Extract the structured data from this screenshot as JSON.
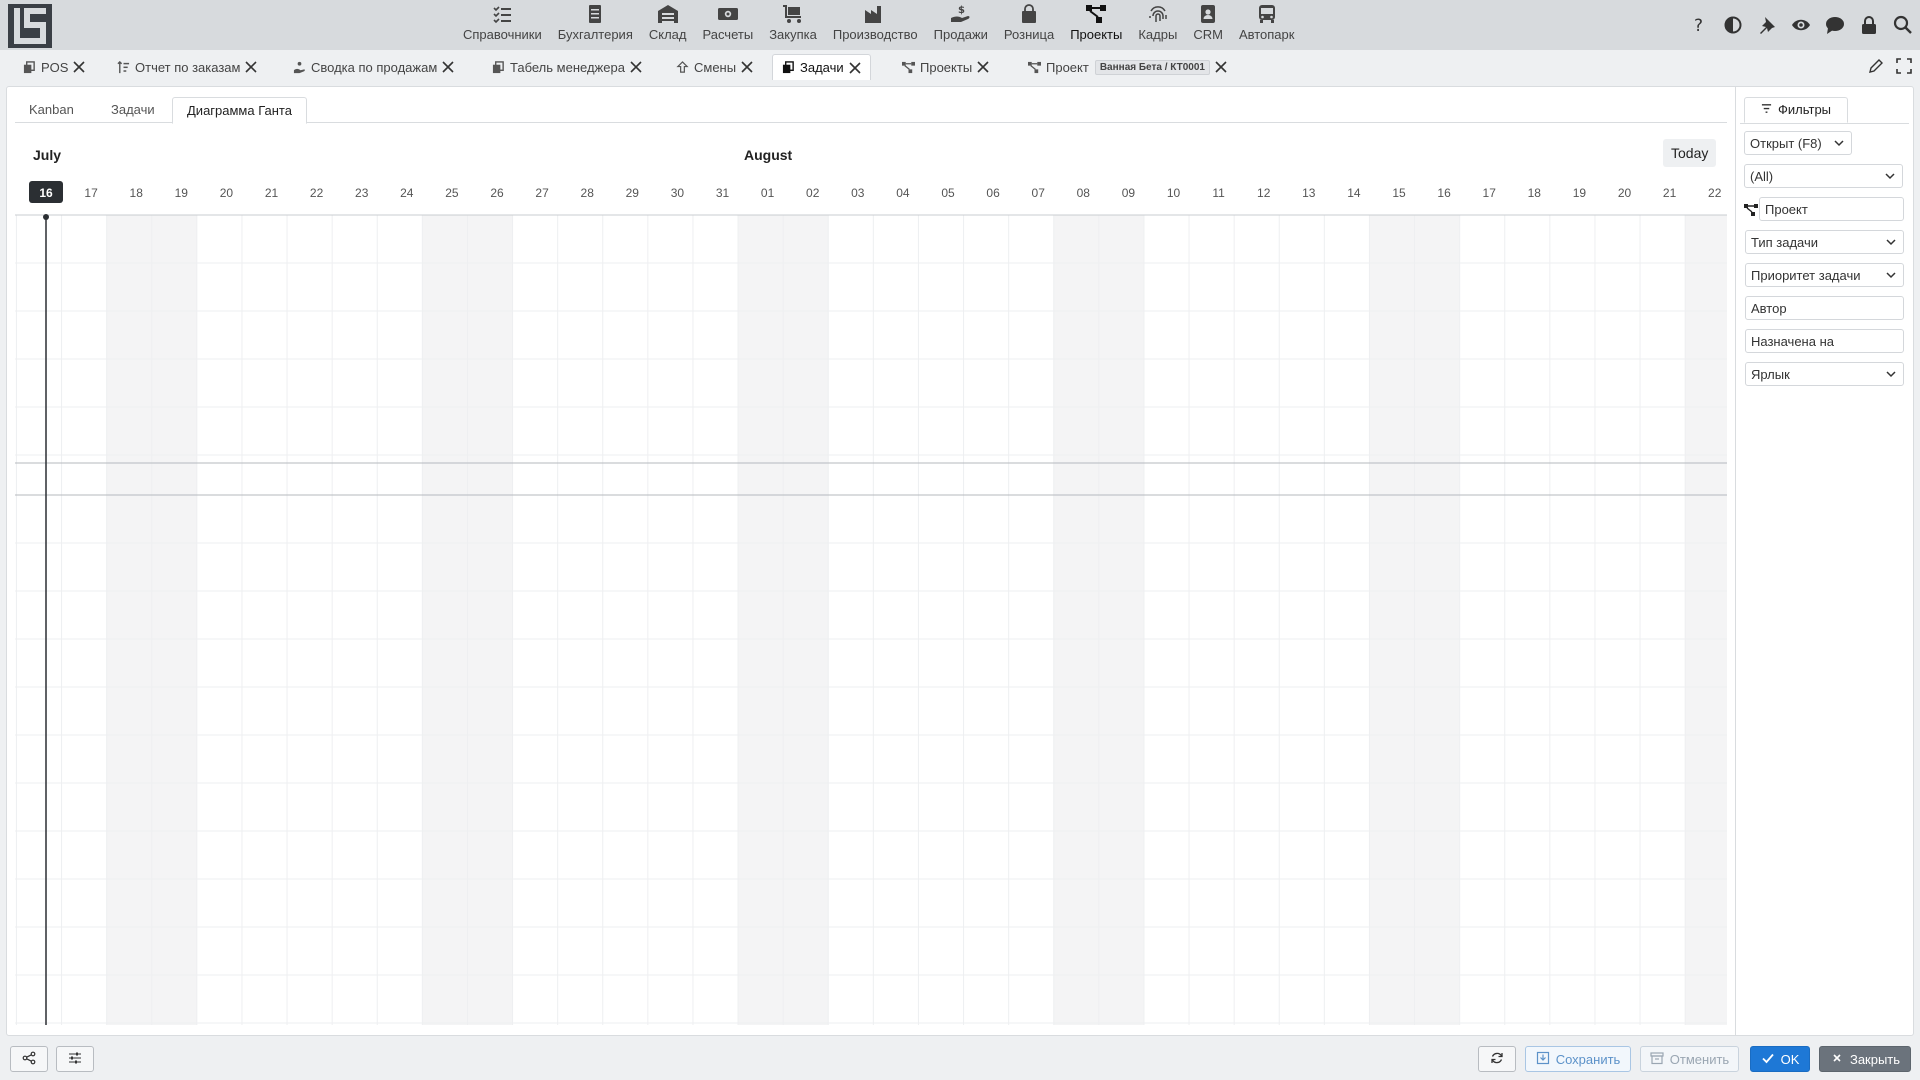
{
  "modules": [
    {
      "label": "Справочники",
      "icon": "list-check-icon"
    },
    {
      "label": "Бухгалтерия",
      "icon": "ledger-icon"
    },
    {
      "label": "Склад",
      "icon": "warehouse-icon"
    },
    {
      "label": "Расчеты",
      "icon": "money-icon"
    },
    {
      "label": "Закупка",
      "icon": "cart-icon"
    },
    {
      "label": "Производство",
      "icon": "factory-icon"
    },
    {
      "label": "Продажи",
      "icon": "hand-coin-icon"
    },
    {
      "label": "Розница",
      "icon": "shopping-bag-icon"
    },
    {
      "label": "Проекты",
      "icon": "project-tree-icon",
      "active": true
    },
    {
      "label": "Кадры",
      "icon": "fingerprint-icon"
    },
    {
      "label": "CRM",
      "icon": "contact-card-icon"
    },
    {
      "label": "Автопарк",
      "icon": "bus-icon"
    }
  ],
  "tools": [
    "help-icon",
    "contrast-icon",
    "pin-icon",
    "eye-icon",
    "chat-icon",
    "lock-icon",
    "search-icon"
  ],
  "doc_tabs": [
    {
      "label": "POS",
      "icon": "copy-icon"
    },
    {
      "label": "Отчет по заказам",
      "icon": "sort-filter-icon"
    },
    {
      "label": "Сводка по продажам",
      "icon": "hand-coin-icon"
    },
    {
      "label": "Табель менеджера",
      "icon": "copy-icon"
    },
    {
      "label": "Смены",
      "icon": "refresh-icon"
    },
    {
      "label": "Задачи",
      "icon": "copy-icon",
      "active": true
    },
    {
      "label": "Проекты",
      "icon": "project-tree-icon"
    },
    {
      "label": "Проект",
      "icon": "project-tree-icon",
      "badge": "Ванная Бета / КТ0001"
    }
  ],
  "sub_tabs": [
    {
      "label": "Kanban"
    },
    {
      "label": "Задачи"
    },
    {
      "label": "Диаграмма Ганта",
      "active": true
    }
  ],
  "gantt": {
    "months": [
      {
        "label": "July",
        "start_index": 0
      },
      {
        "label": "August",
        "start_index": 16
      }
    ],
    "days": [
      "16",
      "17",
      "18",
      "19",
      "20",
      "21",
      "22",
      "23",
      "24",
      "25",
      "26",
      "27",
      "28",
      "29",
      "30",
      "31",
      "01",
      "02",
      "03",
      "04",
      "05",
      "06",
      "07",
      "08",
      "09",
      "10",
      "11",
      "12",
      "13",
      "14",
      "15",
      "16",
      "17",
      "18",
      "19",
      "20",
      "21",
      "22"
    ],
    "today_index": 0,
    "weekend_indices": [
      2,
      3,
      9,
      10,
      16,
      17,
      23,
      24,
      30,
      31,
      37
    ],
    "today_label": "Today"
  },
  "filters": {
    "tab_label": "Фильтры",
    "status": "Открыт (F8)",
    "scope": "(All)",
    "project": "Проект",
    "task_type": "Тип задачи",
    "task_priority": "Приоритет задачи",
    "author": "Автор",
    "assigned_to": "Назначена на",
    "label": "Ярлык"
  },
  "bottom": {
    "save": "Сохранить",
    "cancel": "Отменить",
    "ok": "OK",
    "close": "Закрыть"
  }
}
